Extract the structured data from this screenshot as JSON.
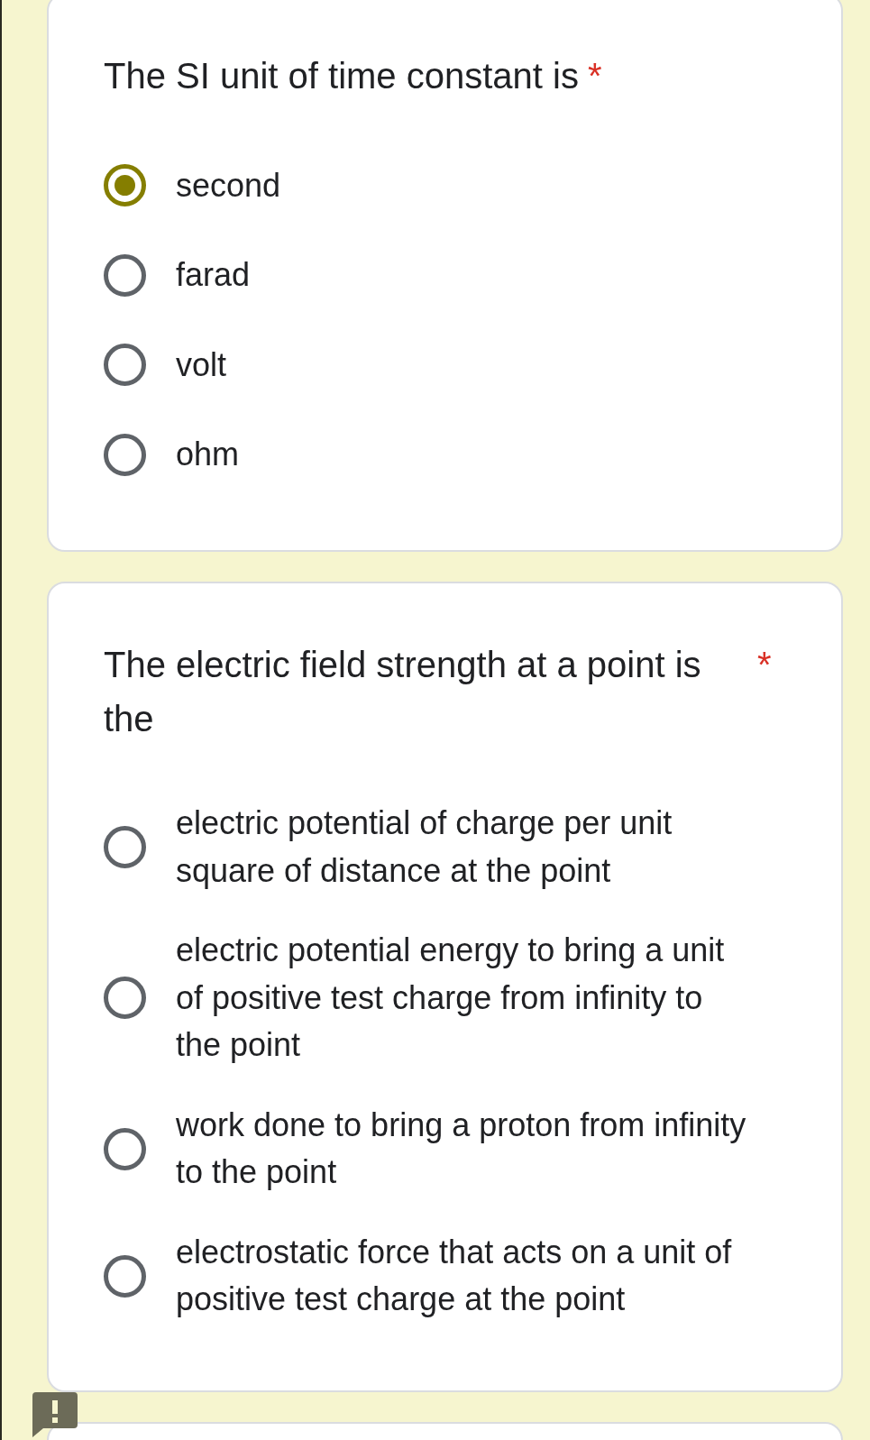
{
  "questions": [
    {
      "title": "The SI unit of time constant is",
      "required_mark": "*",
      "options": [
        {
          "label": "second",
          "selected": true
        },
        {
          "label": "farad",
          "selected": false
        },
        {
          "label": "volt",
          "selected": false
        },
        {
          "label": "ohm",
          "selected": false
        }
      ]
    },
    {
      "title": "The electric field strength at a point is the",
      "required_mark": "*",
      "options": [
        {
          "label": "electric potential of charge per unit square of distance at the point",
          "selected": false
        },
        {
          "label": "electric potential energy to bring a unit of positive test charge from infinity to the point",
          "selected": false
        },
        {
          "label": "work done to bring a proton from infinity to the point",
          "selected": false
        },
        {
          "label": "electrostatic force that acts on a unit of positive test charge at the point",
          "selected": false
        }
      ]
    }
  ]
}
